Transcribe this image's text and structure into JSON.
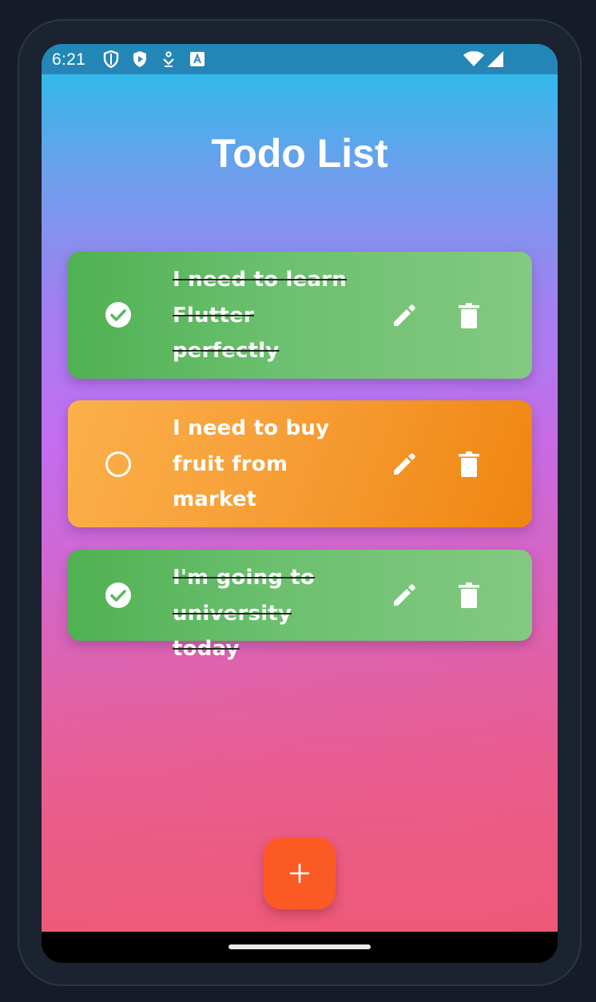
{
  "status_bar": {
    "time": "6:21",
    "left_icons": [
      "shield-outline-icon",
      "play-shield-icon",
      "download-icon",
      "a-square-icon"
    ],
    "right_icons": [
      "wifi-icon",
      "signal-icon"
    ]
  },
  "header": {
    "title": "Todo List"
  },
  "todos": [
    {
      "text": "I need to learn Flutter perfectly",
      "completed": true
    },
    {
      "text": "I need to buy fruit from market",
      "completed": false
    },
    {
      "text": "I'm going to university today",
      "completed": true
    }
  ],
  "fab": {
    "label": "+"
  },
  "colors": {
    "done_card": "#66bb6a",
    "pending_card": "#f7a13a",
    "fab": "#fb5a25",
    "background_top": "#22c0ea",
    "background_mid": "#c46df0",
    "background_bottom": "#ec5d78",
    "frame": "#1b2230"
  }
}
